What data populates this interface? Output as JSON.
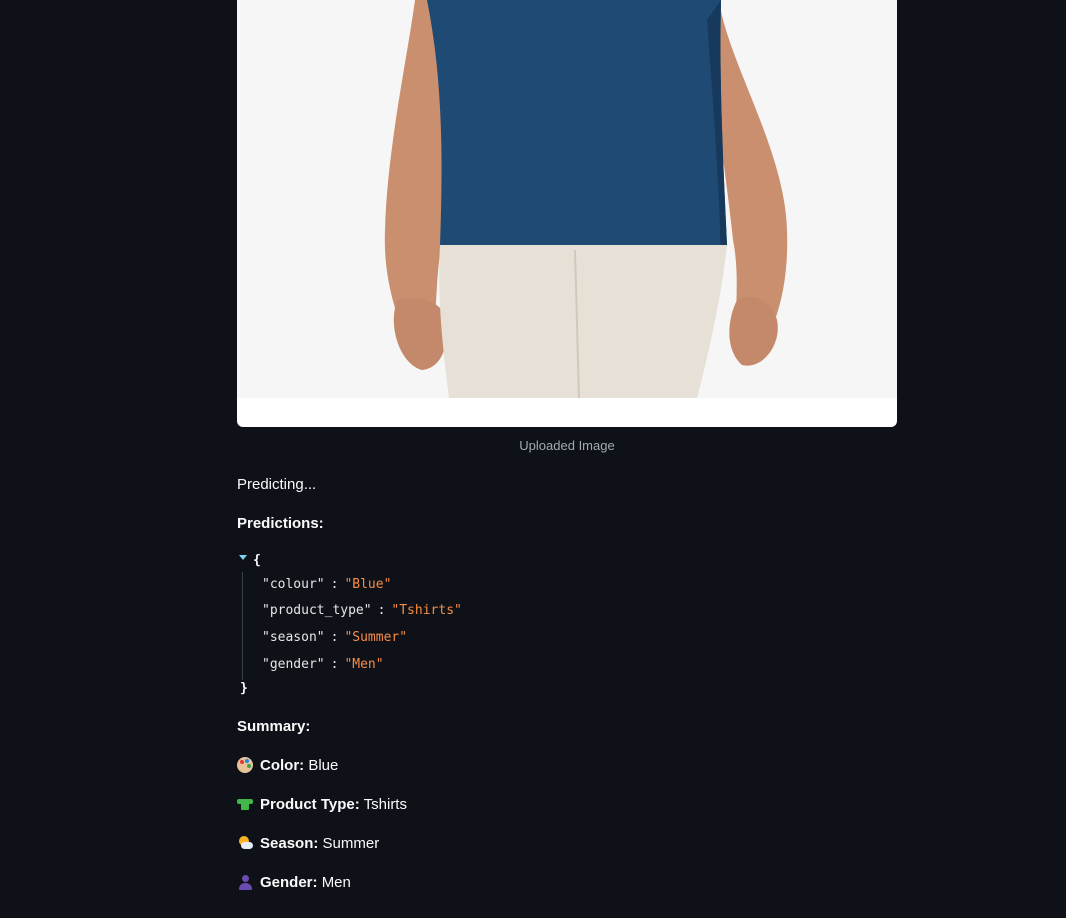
{
  "image": {
    "caption": "Uploaded Image"
  },
  "status": {
    "predicting": "Predicting..."
  },
  "predictions": {
    "heading": "Predictions:",
    "open_brace": "{",
    "close_brace": "}",
    "entries": [
      {
        "key": "\"colour\"",
        "value": "\"Blue\""
      },
      {
        "key": "\"product_type\"",
        "value": "\"Tshirts\""
      },
      {
        "key": "\"season\"",
        "value": "\"Summer\""
      },
      {
        "key": "\"gender\"",
        "value": "\"Men\""
      }
    ]
  },
  "summary": {
    "heading": "Summary:",
    "items": [
      {
        "icon": "palette-icon",
        "label": "Color:",
        "value": "Blue"
      },
      {
        "icon": "tshirt-icon",
        "label": "Product Type:",
        "value": "Tshirts"
      },
      {
        "icon": "sun-behind-cloud-icon",
        "label": "Season:",
        "value": "Summer"
      },
      {
        "icon": "person-icon",
        "label": "Gender:",
        "value": "Men"
      }
    ]
  },
  "colors": {
    "background": "#0e1117",
    "json_value": "#f98d47",
    "caption": "#a3a8b4"
  }
}
